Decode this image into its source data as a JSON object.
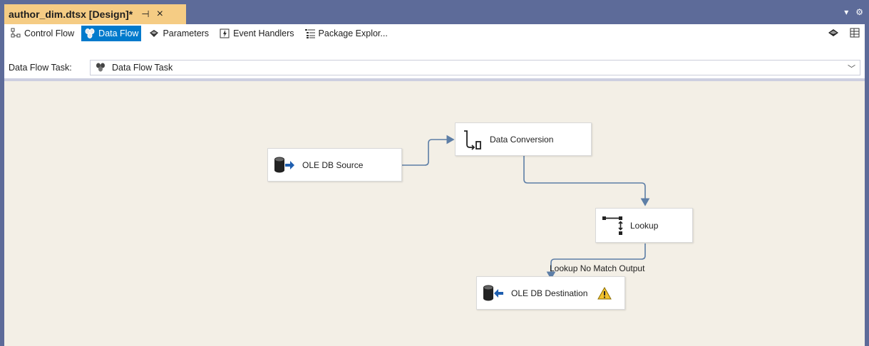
{
  "window": {
    "tab_title": "author_dim.dtsx [Design]*",
    "pin_glyph": "⊣",
    "close_glyph": "×",
    "strip_icons": [
      "dropdown-icon",
      "gear-icon"
    ]
  },
  "designer_tabs": [
    {
      "label": "Control Flow",
      "icon": "control-flow-icon",
      "active": false
    },
    {
      "label": "Data Flow",
      "icon": "data-flow-icon",
      "active": true
    },
    {
      "label": "Parameters",
      "icon": "parameters-icon",
      "active": false
    },
    {
      "label": "Event Handlers",
      "icon": "event-handlers-icon",
      "active": false
    },
    {
      "label": "Package Explor...",
      "icon": "package-explorer-icon",
      "active": false
    }
  ],
  "task_bar": {
    "label": "Data Flow Task:",
    "selected": "Data Flow Task"
  },
  "nodes": {
    "source": {
      "label": "OLE DB Source",
      "icon": "ole-db-source-icon"
    },
    "conversion": {
      "label": "Data Conversion",
      "icon": "data-conversion-icon"
    },
    "lookup": {
      "label": "Lookup",
      "icon": "lookup-icon"
    },
    "destination": {
      "label": "OLE DB Destination",
      "icon": "ole-db-destination-icon",
      "warning": true
    }
  },
  "paths": {
    "lookup_to_destination_label": "Lookup No Match Output"
  },
  "colors": {
    "frame": "#5d6b99",
    "active_tab": "#f5cc84",
    "selected": "#007acc",
    "canvas": "#f3efe6",
    "connector": "#5d7ea6"
  }
}
